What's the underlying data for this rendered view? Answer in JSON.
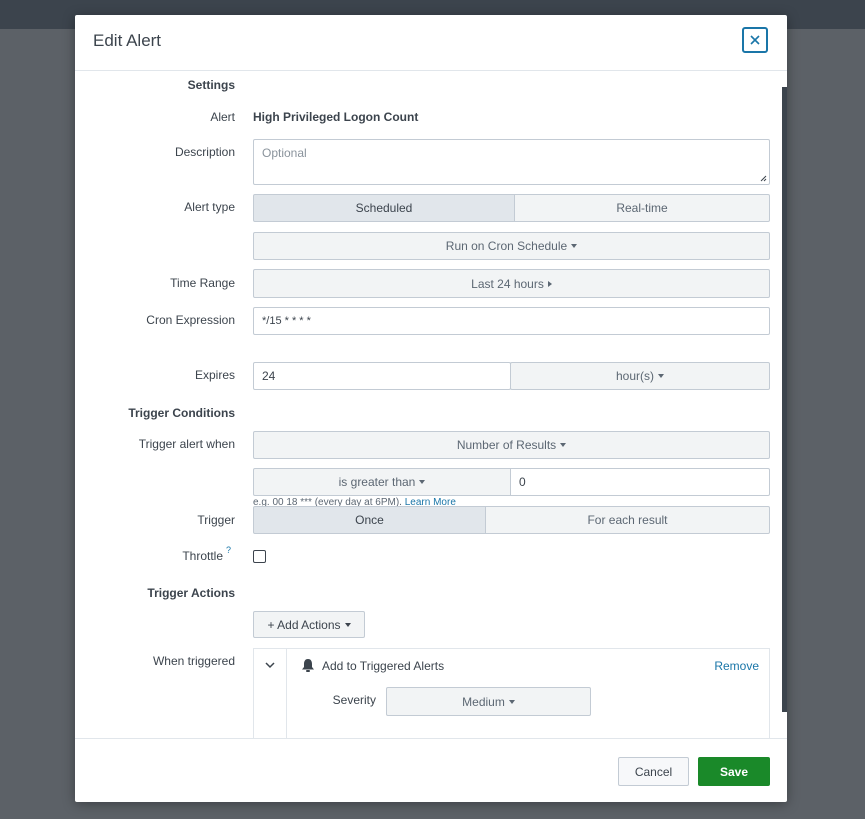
{
  "modal": {
    "title": "Edit Alert",
    "close_label": "×"
  },
  "settings": {
    "section_label": "Settings",
    "alert_label": "Alert",
    "alert_name": "High Privileged Logon Count",
    "description_label": "Description",
    "description_placeholder": "Optional",
    "alert_type_label": "Alert type",
    "alert_type_options": [
      "Scheduled",
      "Real-time"
    ],
    "alert_type_selected": "Scheduled",
    "schedule_select": "Run on Cron Schedule",
    "time_range_label": "Time Range",
    "time_range_value": "Last 24 hours",
    "cron_label": "Cron Expression",
    "cron_value": "*/15 * * * *",
    "cron_help": "e.g. 00 18 *** (every day at 6PM).",
    "cron_help_link": "Learn More",
    "expires_label": "Expires",
    "expires_value": "24",
    "expires_unit": "hour(s)"
  },
  "trigger": {
    "section_label": "Trigger Conditions",
    "when_label": "Trigger alert when",
    "when_value": "Number of Results",
    "comparator": "is greater than",
    "threshold": "0",
    "trigger_label": "Trigger",
    "trigger_options": [
      "Once",
      "For each result"
    ],
    "trigger_selected": "Once",
    "throttle_label": "Throttle",
    "throttle_help_mark": "?",
    "throttle_checked": false
  },
  "actions": {
    "section_label": "Trigger Actions",
    "add_button": "+ Add Actions",
    "when_triggered_label": "When triggered",
    "action_name": "Add to Triggered Alerts",
    "remove_label": "Remove",
    "severity_label": "Severity",
    "severity_value": "Medium"
  },
  "footer": {
    "cancel_label": "Cancel",
    "save_label": "Save"
  },
  "colors": {
    "accent": "#1a76a8",
    "save_green": "#1a8929",
    "overlay": "#5c6167"
  }
}
